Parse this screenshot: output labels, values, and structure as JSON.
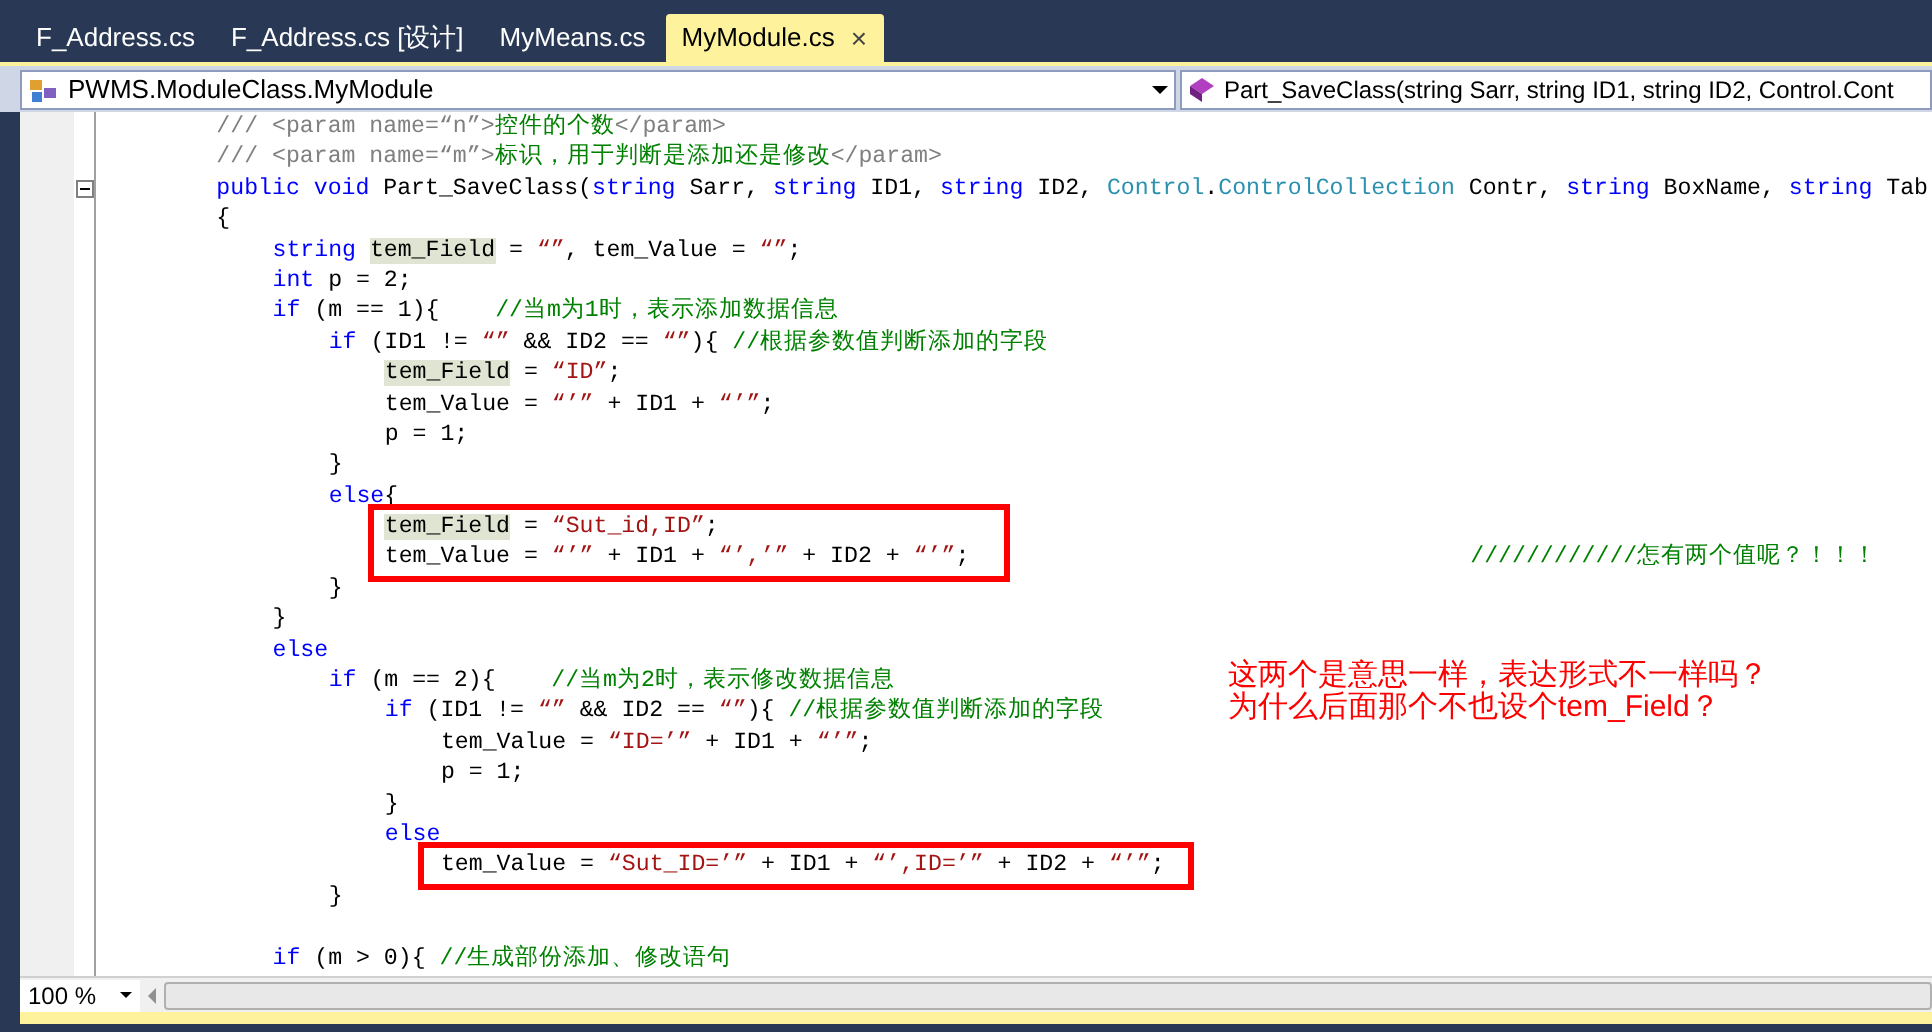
{
  "tabs": [
    {
      "label": "F_Address.cs",
      "selected": false
    },
    {
      "label": "F_Address.cs [设计]",
      "selected": false
    },
    {
      "label": "MyMeans.cs",
      "selected": false
    },
    {
      "label": "MyModule.cs",
      "selected": true,
      "close": "×"
    }
  ],
  "navigation": {
    "class_combo": "PWMS.ModuleClass.MyModule",
    "member_combo": "Part_SaveClass(string Sarr, string ID1, string ID2, Control.Cont"
  },
  "code": {
    "lines": [
      {
        "tokens": [
          {
            "kind": "doc",
            "text": "        /// <param name=“n”>"
          },
          {
            "kind": "comment",
            "text": "控件的个数"
          },
          {
            "kind": "doc",
            "text": "</param>"
          }
        ]
      },
      {
        "tokens": [
          {
            "kind": "doc",
            "text": "        /// <param name=“m”>"
          },
          {
            "kind": "comment",
            "text": "标识，用于判断是添加还是修改"
          },
          {
            "kind": "doc",
            "text": "</param>"
          }
        ]
      },
      {
        "collapsible": true,
        "tokens": [
          {
            "kind": "keyword",
            "text": "        public void"
          },
          {
            "kind": "plain",
            "text": " Part_SaveClass("
          },
          {
            "kind": "keyword",
            "text": "string"
          },
          {
            "kind": "plain",
            "text": " Sarr, "
          },
          {
            "kind": "keyword",
            "text": "string"
          },
          {
            "kind": "plain",
            "text": " ID1, "
          },
          {
            "kind": "keyword",
            "text": "string"
          },
          {
            "kind": "plain",
            "text": " ID2, "
          },
          {
            "kind": "type",
            "text": "Control"
          },
          {
            "kind": "plain",
            "text": "."
          },
          {
            "kind": "type",
            "text": "ControlCollection"
          },
          {
            "kind": "plain",
            "text": " Contr, "
          },
          {
            "kind": "keyword",
            "text": "string"
          },
          {
            "kind": "plain",
            "text": " BoxName, "
          },
          {
            "kind": "keyword",
            "text": "string"
          },
          {
            "kind": "plain",
            "text": " Tab"
          }
        ]
      },
      {
        "tokens": [
          {
            "kind": "plain",
            "text": "        {"
          }
        ]
      },
      {
        "tokens": [
          {
            "kind": "keyword",
            "text": "            string "
          },
          {
            "kind": "highlight",
            "text": "tem_Field"
          },
          {
            "kind": "plain",
            "text": " = "
          },
          {
            "kind": "string",
            "text": "“”"
          },
          {
            "kind": "plain",
            "text": ", tem_Value = "
          },
          {
            "kind": "string",
            "text": "“”"
          },
          {
            "kind": "plain",
            "text": ";"
          }
        ]
      },
      {
        "tokens": [
          {
            "kind": "keyword",
            "text": "            int"
          },
          {
            "kind": "plain",
            "text": " p = 2;"
          }
        ]
      },
      {
        "tokens": [
          {
            "kind": "keyword",
            "text": "            if"
          },
          {
            "kind": "plain",
            "text": " (m == 1){    "
          },
          {
            "kind": "comment",
            "text": "//当m为1时，表示添加数据信息"
          }
        ]
      },
      {
        "tokens": [
          {
            "kind": "keyword",
            "text": "                if"
          },
          {
            "kind": "plain",
            "text": " (ID1 != "
          },
          {
            "kind": "string",
            "text": "“”"
          },
          {
            "kind": "plain",
            "text": " && ID2 == "
          },
          {
            "kind": "string",
            "text": "“”"
          },
          {
            "kind": "plain",
            "text": "){ "
          },
          {
            "kind": "comment",
            "text": "//根据参数值判断添加的字段"
          }
        ]
      },
      {
        "tokens": [
          {
            "kind": "highlight",
            "text": "                    tem_Field"
          },
          {
            "kind": "plain",
            "text": " = "
          },
          {
            "kind": "string",
            "text": "“ID”"
          },
          {
            "kind": "plain",
            "text": ";"
          }
        ]
      },
      {
        "tokens": [
          {
            "kind": "plain",
            "text": "                    tem_Value = "
          },
          {
            "kind": "string",
            "text": "“’”"
          },
          {
            "kind": "plain",
            "text": " + ID1 + "
          },
          {
            "kind": "string",
            "text": "“’”"
          },
          {
            "kind": "plain",
            "text": ";"
          }
        ]
      },
      {
        "tokens": [
          {
            "kind": "plain",
            "text": "                    p = 1;"
          }
        ]
      },
      {
        "tokens": [
          {
            "kind": "plain",
            "text": "                }"
          }
        ]
      },
      {
        "tokens": [
          {
            "kind": "keyword",
            "text": "                else"
          },
          {
            "kind": "plain",
            "text": "{"
          }
        ]
      },
      {
        "tokens": [
          {
            "kind": "highlight",
            "text": "                    tem_Field"
          },
          {
            "kind": "plain",
            "text": " = "
          },
          {
            "kind": "string",
            "text": "“Sut_id,ID”"
          },
          {
            "kind": "plain",
            "text": ";"
          }
        ]
      },
      {
        "tokens": [
          {
            "kind": "plain",
            "text": "                    tem_Value = "
          },
          {
            "kind": "string",
            "text": "“’”"
          },
          {
            "kind": "plain",
            "text": " + ID1 + "
          },
          {
            "kind": "string",
            "text": "“’,’”"
          },
          {
            "kind": "plain",
            "text": " + ID2 + "
          },
          {
            "kind": "string",
            "text": "“’”"
          },
          {
            "kind": "plain",
            "text": ";                                    "
          },
          {
            "kind": "comment",
            "text": "////////////怎有两个值呢？！！！"
          }
        ]
      },
      {
        "tokens": [
          {
            "kind": "plain",
            "text": "                }"
          }
        ]
      },
      {
        "tokens": [
          {
            "kind": "plain",
            "text": "            }"
          }
        ]
      },
      {
        "tokens": [
          {
            "kind": "keyword",
            "text": "            else"
          }
        ]
      },
      {
        "tokens": [
          {
            "kind": "keyword",
            "text": "                if"
          },
          {
            "kind": "plain",
            "text": " (m == 2){    "
          },
          {
            "kind": "comment",
            "text": "//当m为2时，表示修改数据信息"
          }
        ]
      },
      {
        "tokens": [
          {
            "kind": "keyword",
            "text": "                    if"
          },
          {
            "kind": "plain",
            "text": " (ID1 != "
          },
          {
            "kind": "string",
            "text": "“”"
          },
          {
            "kind": "plain",
            "text": " && ID2 == "
          },
          {
            "kind": "string",
            "text": "“”"
          },
          {
            "kind": "plain",
            "text": "){ "
          },
          {
            "kind": "comment",
            "text": "//根据参数值判断添加的字段"
          }
        ]
      },
      {
        "tokens": [
          {
            "kind": "plain",
            "text": "                        tem_Value = "
          },
          {
            "kind": "string",
            "text": "“ID=’”"
          },
          {
            "kind": "plain",
            "text": " + ID1 + "
          },
          {
            "kind": "string",
            "text": "“’”"
          },
          {
            "kind": "plain",
            "text": ";"
          }
        ]
      },
      {
        "tokens": [
          {
            "kind": "plain",
            "text": "                        p = 1;"
          }
        ]
      },
      {
        "tokens": [
          {
            "kind": "plain",
            "text": "                    }"
          }
        ]
      },
      {
        "tokens": [
          {
            "kind": "keyword",
            "text": "                    else"
          }
        ]
      },
      {
        "tokens": [
          {
            "kind": "plain",
            "text": "                        tem_Value = "
          },
          {
            "kind": "string",
            "text": "“Sut_ID=’”"
          },
          {
            "kind": "plain",
            "text": " + ID1 + "
          },
          {
            "kind": "string",
            "text": "“’,ID=’”"
          },
          {
            "kind": "plain",
            "text": " + ID2 + "
          },
          {
            "kind": "string",
            "text": "“’”"
          },
          {
            "kind": "plain",
            "text": ";"
          }
        ]
      },
      {
        "tokens": [
          {
            "kind": "plain",
            "text": "                }"
          }
        ]
      },
      {
        "blank_before": true,
        "tokens": [
          {
            "kind": "keyword",
            "text": "            if"
          },
          {
            "kind": "plain",
            "text": " (m > 0){ "
          },
          {
            "kind": "comment",
            "text": "//生成部份添加、修改语句"
          }
        ]
      }
    ]
  },
  "annotation": {
    "lines": [
      "这两个是意思一样，表达形式不一样吗？",
      "为什么后面那个不也设个tem_Field？"
    ]
  },
  "zoom": "100 %"
}
